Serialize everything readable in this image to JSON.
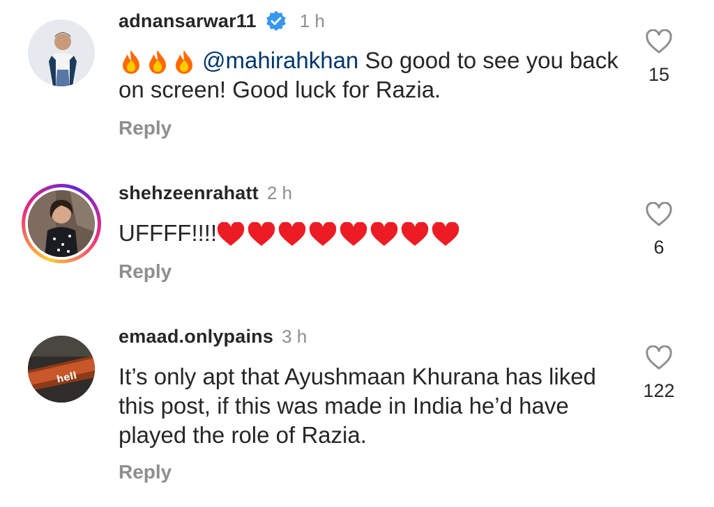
{
  "comments": [
    {
      "username": "adnansarwar11",
      "verified": true,
      "time": "1 h",
      "emoji_prefix": "🔥🔥🔥",
      "mention": "@mahirahkhan",
      "text": " So good to see you back on screen! Good luck for Razia.",
      "reply_label": "Reply",
      "likes": "15",
      "avatar_icon": "person-avatar-icon"
    },
    {
      "username": "shehzeenrahatt",
      "verified": false,
      "time": "2 h",
      "text": "UFFFF!!!!",
      "emoji_suffix": "❤❤❤❤❤❤❤❤",
      "reply_label": "Reply",
      "likes": "6",
      "has_story_ring": true,
      "avatar_icon": "person-avatar-icon"
    },
    {
      "username": "emaad.onlypains",
      "verified": false,
      "time": "3 h",
      "text": "It’s only apt that Ayushmaan Khurana has liked this post, if this was made in India he’d have played the role of Razia.",
      "reply_label": "Reply",
      "likes": "122",
      "avatar_label": "hell",
      "avatar_icon": "sign-avatar-icon"
    }
  ],
  "colors": {
    "text": "#262626",
    "muted": "#8e8e8e",
    "mention": "#00376b",
    "verified": "#3897f0",
    "heart": "#ed1c24",
    "fire": "#ff6a00"
  }
}
